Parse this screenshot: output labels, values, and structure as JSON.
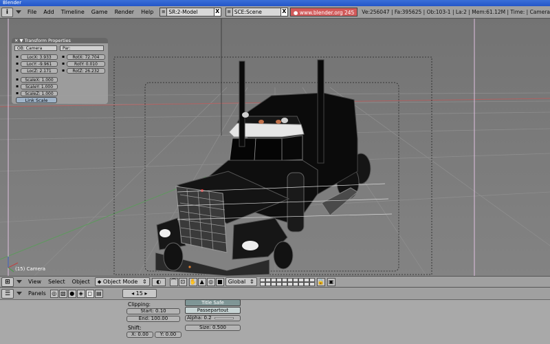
{
  "window": {
    "title": "Blender"
  },
  "info_header": {
    "menu": [
      "File",
      "Add",
      "Timeline",
      "Game",
      "Render",
      "Help"
    ],
    "screen_prefix": "SR:2-",
    "screen_name": "Model",
    "scene_prefix": "SCE:",
    "scene_name": "Scene",
    "close_glyph": "X",
    "url": "www.blender.org 245",
    "stats": "Ve:256047 | Fa:395625 | Ob:103-1 | La:2 | Mem:61.12M | Time: | Camera"
  },
  "transform_panel": {
    "title": "Transform Properties",
    "object_field": "OB: Camera",
    "parent_field": "Par:",
    "loc": [
      "LocX: 3.933",
      "LocY: -9.961",
      "LocZ: 2.171"
    ],
    "rot": [
      "RotX: 72.704",
      "RotY: 0.010",
      "RotZ: 26.232"
    ],
    "scale": [
      "ScaleX: 1.000",
      "ScaleY: 1.000",
      "ScaleZ: 1.000"
    ],
    "link_scale": "Link Scale"
  },
  "viewport": {
    "camera_label": "(15) Camera"
  },
  "view_header": {
    "menu": [
      "View",
      "Select",
      "Object"
    ],
    "mode": "Object Mode",
    "orientation": "Global"
  },
  "buttons_header": {
    "panels_label": "Panels",
    "frame": "15"
  },
  "buttons": {
    "clipping_label": "Clipping:",
    "start": "Start: 0.10",
    "end": "End: 100.00",
    "shift_label": "Shift:",
    "shift_x": "X: 0.00",
    "shift_y": "Y: 0.00",
    "title_safe": "Title Safe",
    "passepartout": "Passepartout",
    "alpha": "Alpha: 0.2",
    "size": "Size: 0.500"
  },
  "colors": {
    "title_bar": "#2a5fd0",
    "url_badge": "#d25a5a",
    "panel": "#a0a0a0"
  }
}
